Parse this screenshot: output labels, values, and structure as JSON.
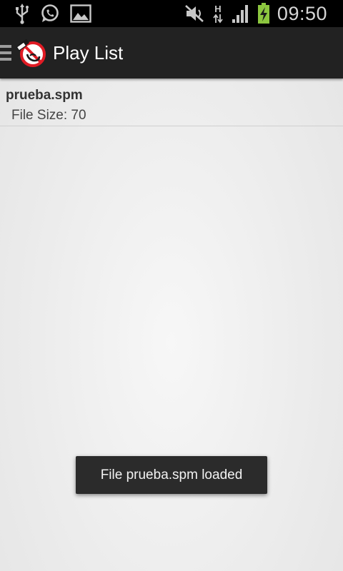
{
  "status_bar": {
    "left_icons": [
      "usb-icon",
      "whatsapp-icon",
      "image-icon"
    ],
    "right_icons": [
      "mute-icon",
      "network-h-icon",
      "signal-icon",
      "battery-charging-icon"
    ],
    "network_label": "H",
    "time": "09:50",
    "battery_color": "#8cc63f"
  },
  "action_bar": {
    "title": "Play List",
    "logo_color": "#e01b24"
  },
  "playlist": {
    "items": [
      {
        "name": "prueba.spm",
        "size_label": "File Size: 70"
      }
    ]
  },
  "toast": {
    "message": "File prueba.spm loaded"
  }
}
